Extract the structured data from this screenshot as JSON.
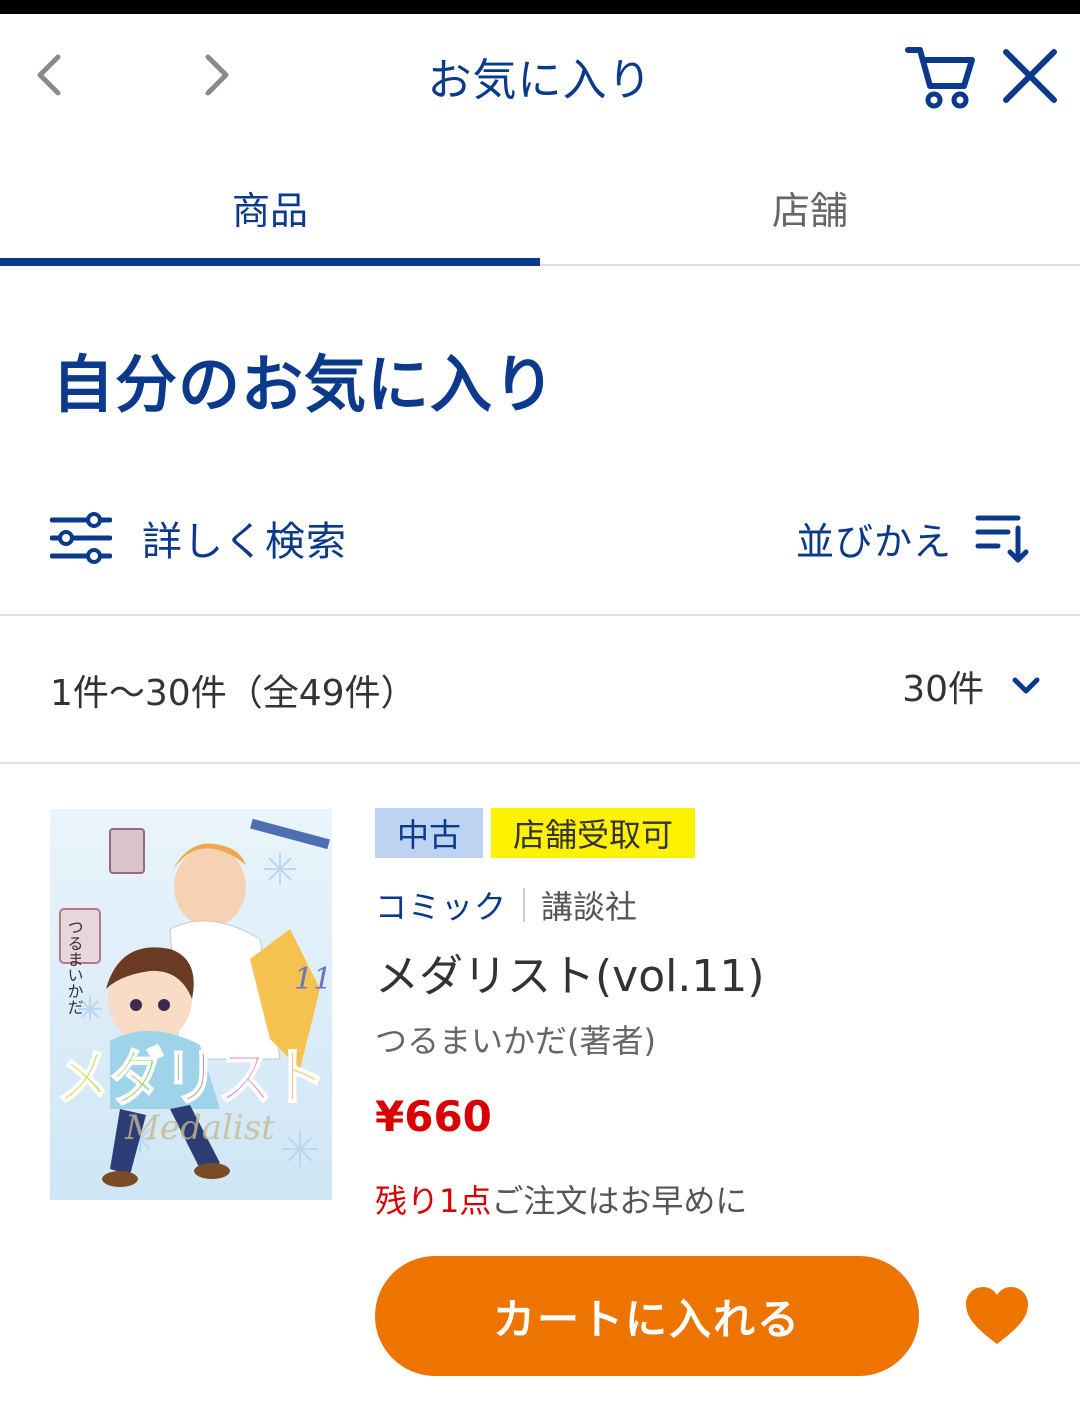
{
  "nav": {
    "title": "お気に入り",
    "back_icon": "chevron-left-icon",
    "forward_icon": "chevron-right-icon",
    "cart_icon": "cart-icon",
    "close_icon": "close-icon"
  },
  "tabs": [
    {
      "label": "商品",
      "active": true
    },
    {
      "label": "店舗",
      "active": false
    }
  ],
  "heading": "自分のお気に入り",
  "toolbar": {
    "filter_label": "詳しく検索",
    "sort_label": "並びかえ"
  },
  "results": {
    "count_text": "1件〜30件（全49件）",
    "per_page": "30件"
  },
  "product": {
    "badges": {
      "used": "中古",
      "store_pickup": "店舗受取可"
    },
    "genre": "コミック",
    "publisher": "講談社",
    "title": "メダリスト(vol.11)",
    "author": "つるまいかだ(著者)",
    "price": "¥660",
    "stock_warning": "残り1点",
    "stock_note": "ご注文はお早めに",
    "cover": {
      "title_art": "メダリスト",
      "author_art": "つるまいかだ",
      "volume": "11",
      "script_art": "Medalist"
    },
    "add_to_cart_label": "カートに入れる",
    "favorite": true
  },
  "colors": {
    "brand_blue": "#0b3a8c",
    "accent_orange": "#ee7400",
    "price_red": "#d90000",
    "badge_used_bg": "#bcd3f1",
    "badge_store_bg": "#fff200"
  }
}
